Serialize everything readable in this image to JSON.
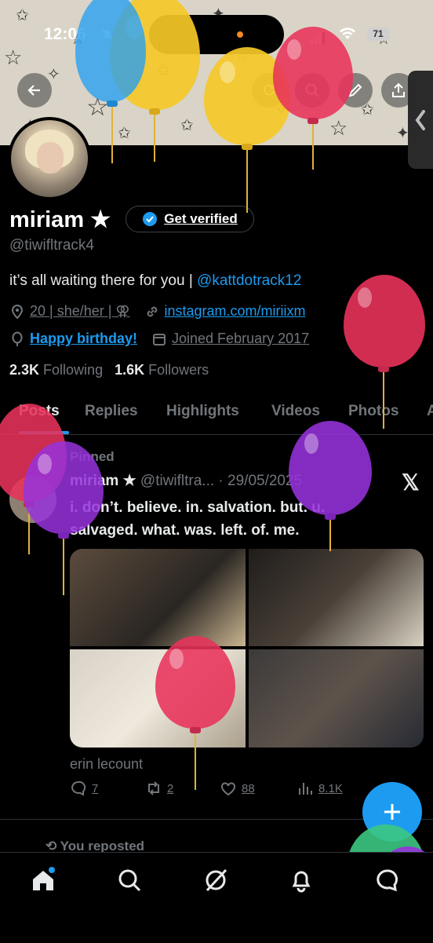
{
  "status_bar": {
    "time": "12:06",
    "battery": "71"
  },
  "profile": {
    "name": "miriam ★",
    "get_verified": "Get verified",
    "handle": "@tiwifltrack4",
    "bio_text": "it’s all waiting there for you | ",
    "bio_mention": "@kattdotrack12",
    "location": "20 | she/her | ⚢",
    "website": "instagram.com/miriixm",
    "birthday": "Happy birthday!",
    "joined": "Joined February 2017",
    "following_count": "2.3K",
    "following_label": "Following",
    "followers_count": "1.6K",
    "followers_label": "Followers"
  },
  "tabs": [
    "Posts",
    "Replies",
    "Highlights",
    "Videos",
    "Photos",
    "A"
  ],
  "post": {
    "pinned": "Pinned",
    "author": "miriam ★",
    "handle_date": "@tiwifltra... · 29/05/2025",
    "text": "i. don’t. believe. in. salvation. but. u. salvaged. what. was. left. of. me.",
    "credit": "erin lecount",
    "replies": "7",
    "reposts": "2",
    "likes": "88",
    "views": "8.1K"
  },
  "next_item": {
    "reposted": "You reposted"
  },
  "icons": [
    "back-arrow-icon",
    "refresh-icon",
    "search-icon",
    "edit-icon",
    "share-icon",
    "location-pin-icon",
    "link-icon",
    "balloon-icon",
    "calendar-icon",
    "x-logo-icon",
    "reply-icon",
    "repost-icon",
    "like-icon",
    "views-icon",
    "plus-icon",
    "home-icon",
    "explore-icon",
    "grok-icon",
    "notifications-icon",
    "messages-icon"
  ],
  "colors": {
    "accent": "#1d9bf0",
    "background": "#000000",
    "muted": "#71767b",
    "text": "#e7e9ea"
  }
}
